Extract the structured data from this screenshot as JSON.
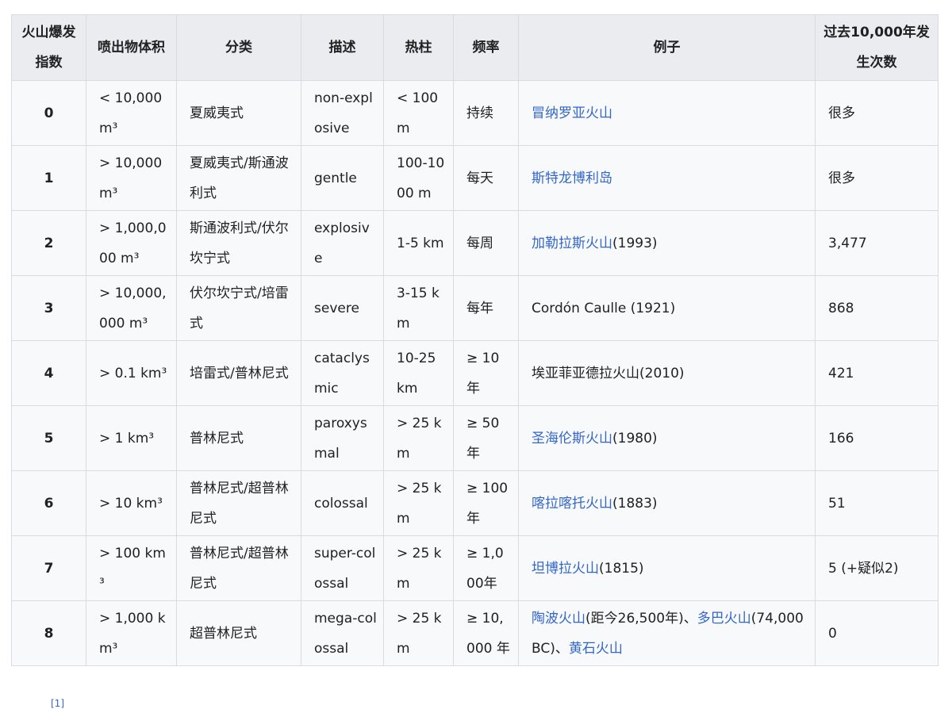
{
  "table": {
    "headers": [
      "火山爆发指数",
      "喷出物体积",
      "分类",
      "描述",
      "热柱",
      "频率",
      "例子",
      "过去10,000年发生次数"
    ],
    "rows": [
      {
        "index": "0",
        "volume": "< 10,000 m³",
        "classification": "夏威夷式",
        "description": "non-explosive",
        "plume": "< 100 m",
        "frequency": "持续",
        "example": [
          {
            "text": "冒纳罗亚火山",
            "link": true
          }
        ],
        "occurrences": "很多"
      },
      {
        "index": "1",
        "volume": "> 10,000 m³",
        "classification": "夏威夷式/斯通波利式",
        "description": "gentle",
        "plume": "100-1000 m",
        "frequency": "每天",
        "example": [
          {
            "text": "斯特龙博利岛",
            "link": true
          }
        ],
        "occurrences": "很多"
      },
      {
        "index": "2",
        "volume": "> 1,000,000 m³",
        "classification": "斯通波利式/伏尔坎宁式",
        "description": "explosive",
        "plume": "1-5 km",
        "frequency": "每周",
        "example": [
          {
            "text": "加勒拉斯火山",
            "link": true
          },
          {
            "text": "(1993)",
            "link": false
          }
        ],
        "occurrences": "3,477"
      },
      {
        "index": "3",
        "volume": "> 10,000,000 m³",
        "classification": "伏尔坎宁式/培雷式",
        "description": "severe",
        "plume": "3-15 km",
        "frequency": "每年",
        "example": [
          {
            "text": "Cordón Caulle (1921)",
            "link": false
          }
        ],
        "occurrences": "868"
      },
      {
        "index": "4",
        "volume": "> 0.1 km³",
        "classification": "培雷式/普林尼式",
        "description": "cataclysmic",
        "plume": "10-25 km",
        "frequency": "≥ 10 年",
        "example": [
          {
            "text": "埃亚菲亚德拉火山(2010)",
            "link": false
          }
        ],
        "occurrences": "421"
      },
      {
        "index": "5",
        "volume": "> 1 km³",
        "classification": "普林尼式",
        "description": "paroxysmal",
        "plume": "> 25 km",
        "frequency": "≥ 50 年",
        "example": [
          {
            "text": "圣海伦斯火山",
            "link": true
          },
          {
            "text": "(1980)",
            "link": false
          }
        ],
        "occurrences": "166"
      },
      {
        "index": "6",
        "volume": "> 10 km³",
        "classification": "普林尼式/超普林尼式",
        "description": "colossal",
        "plume": "> 25 km",
        "frequency": "≥ 100 年",
        "example": [
          {
            "text": "喀拉喀托火山",
            "link": true
          },
          {
            "text": "(1883)",
            "link": false
          }
        ],
        "occurrences": "51"
      },
      {
        "index": "7",
        "volume": "> 100 km³",
        "classification": "普林尼式/超普林尼式",
        "description": "super-colossal",
        "plume": "> 25 km",
        "frequency": "≥ 1,000年",
        "example": [
          {
            "text": "坦博拉火山",
            "link": true
          },
          {
            "text": "(1815)",
            "link": false
          }
        ],
        "occurrences": "5 (+疑似2)"
      },
      {
        "index": "8",
        "volume": "> 1,000 km³",
        "classification": "超普林尼式",
        "description": "mega-colossal",
        "plume": "> 25 km",
        "frequency": "≥ 10,000 年",
        "example": [
          {
            "text": "陶波火山",
            "link": true
          },
          {
            "text": "(距今26,500年)、",
            "link": false
          },
          {
            "text": "多巴火山",
            "link": true
          },
          {
            "text": "(74,000 BC)、",
            "link": false
          },
          {
            "text": "黄石火山",
            "link": true
          }
        ],
        "occurrences": "0"
      }
    ]
  },
  "footnote": "[1]",
  "colors": {
    "link": "#3366cc",
    "header_bg": "#eaecf0",
    "cell_bg": "#f8f9fa",
    "border": "#d8dce2"
  }
}
